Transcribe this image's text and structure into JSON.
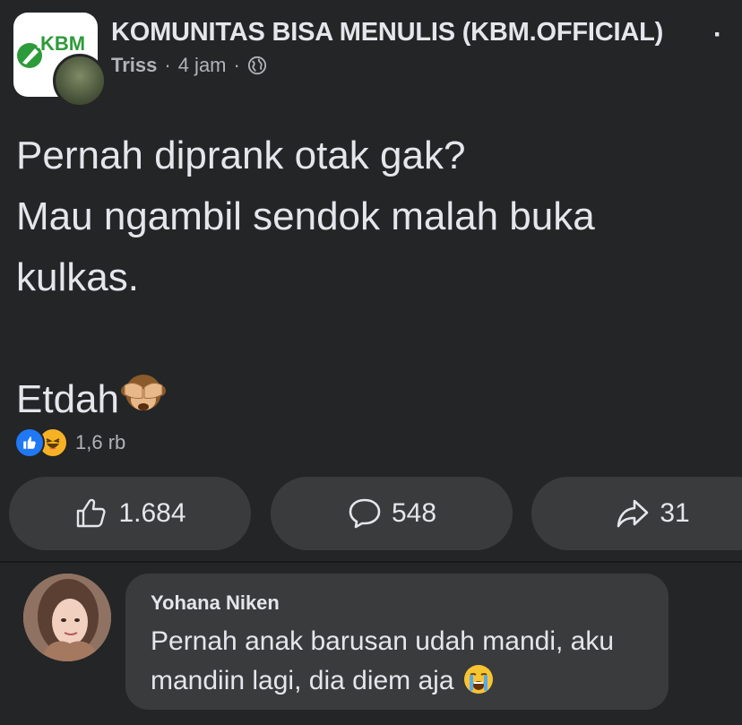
{
  "header": {
    "group_logo_text": "KBM",
    "group_name": "KOMUNITAS BISA MENULIS (KBM.OFFICIAL)",
    "more_icon": "more-dots-icon",
    "author": "Triss",
    "separator": "·",
    "time": "4 jam",
    "privacy_icon": "globe-icon"
  },
  "post": {
    "lines": [
      "Pernah diprank otak gak?",
      "Mau ngambil sendok malah buka",
      "kulkas."
    ],
    "closing": "Etdah",
    "closing_emoji": "see-no-evil-monkey-icon"
  },
  "reactions": {
    "types": [
      "like-reaction-icon",
      "haha-reaction-icon"
    ],
    "count": "1,6 rb"
  },
  "actions": {
    "like_count": "1.684",
    "comment_count": "548",
    "share_count": "31"
  },
  "comment": {
    "author": "Yohana Niken",
    "lines": [
      "Pernah anak barusan udah mandi, aku",
      "mandiin lagi, dia diem aja"
    ],
    "emoji": "crying-face-icon"
  },
  "colors": {
    "background": "#242526",
    "surface": "#3a3b3c",
    "text_primary": "#e4e6eb",
    "text_secondary": "#b0b3b8",
    "like_blue": "#2078f4",
    "haha_yellow": "#f7b125",
    "brand_green": "#2e9b3a"
  }
}
